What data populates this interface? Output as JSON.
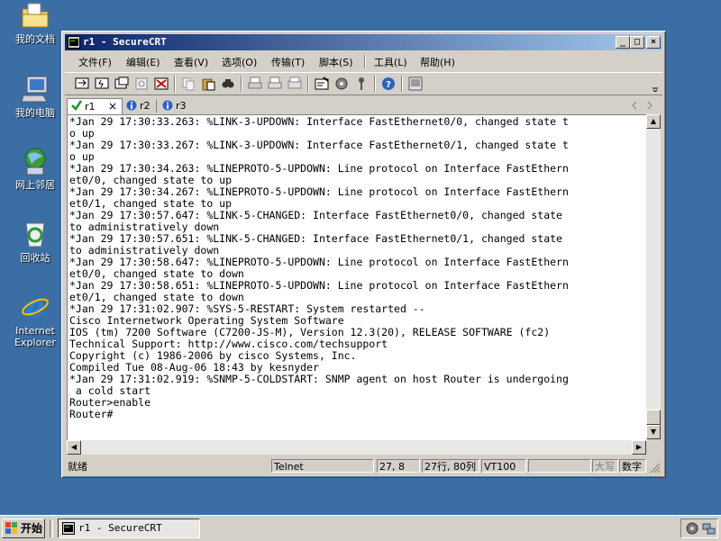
{
  "desktop": {
    "icons": [
      {
        "label": "我的文档",
        "icon": "my-documents-icon"
      },
      {
        "label": "我的电脑",
        "icon": "my-computer-icon"
      },
      {
        "label": "网上邻居",
        "icon": "network-places-icon"
      },
      {
        "label": "回收站",
        "icon": "recycle-bin-icon"
      },
      {
        "label": "Internet\nExplorer",
        "icon": "internet-explorer-icon"
      }
    ]
  },
  "window": {
    "title": "r1 - SecureCRT",
    "menu": [
      "文件(F)",
      "编辑(E)",
      "查看(V)",
      "选项(O)",
      "传输(T)",
      "脚本(S)",
      "工具(L)",
      "帮助(H)"
    ],
    "tabs": [
      {
        "label": "r1",
        "status": "connected",
        "active": true
      },
      {
        "label": "r2",
        "status": "info",
        "active": false
      },
      {
        "label": "r3",
        "status": "info",
        "active": false
      }
    ],
    "terminal_lines": [
      "*Jan 29 17:30:33.263: %LINK-3-UPDOWN: Interface FastEthernet0/0, changed state t",
      "o up",
      "*Jan 29 17:30:33.267: %LINK-3-UPDOWN: Interface FastEthernet0/1, changed state t",
      "o up",
      "*Jan 29 17:30:34.263: %LINEPROTO-5-UPDOWN: Line protocol on Interface FastEthern",
      "et0/0, changed state to up",
      "*Jan 29 17:30:34.267: %LINEPROTO-5-UPDOWN: Line protocol on Interface FastEthern",
      "et0/1, changed state to up",
      "*Jan 29 17:30:57.647: %LINK-5-CHANGED: Interface FastEthernet0/0, changed state",
      "to administratively down",
      "*Jan 29 17:30:57.651: %LINK-5-CHANGED: Interface FastEthernet0/1, changed state",
      "to administratively down",
      "*Jan 29 17:30:58.647: %LINEPROTO-5-UPDOWN: Line protocol on Interface FastEthern",
      "et0/0, changed state to down",
      "*Jan 29 17:30:58.651: %LINEPROTO-5-UPDOWN: Line protocol on Interface FastEthern",
      "et0/1, changed state to down",
      "*Jan 29 17:31:02.907: %SYS-5-RESTART: System restarted --",
      "Cisco Internetwork Operating System Software",
      "IOS (tm) 7200 Software (C7200-JS-M), Version 12.3(20), RELEASE SOFTWARE (fc2)",
      "Technical Support: http://www.cisco.com/techsupport",
      "Copyright (c) 1986-2006 by cisco Systems, Inc.",
      "Compiled Tue 08-Aug-06 18:43 by kesnyder",
      "*Jan 29 17:31:02.919: %SNMP-5-COLDSTART: SNMP agent on host Router is undergoing",
      " a cold start",
      "Router>enable",
      "Router#"
    ],
    "status": {
      "ready": "就绪",
      "protocol": "Telnet",
      "cursor": "27,  8",
      "size": "27行, 80列",
      "emulation": "VT100",
      "blank": "",
      "caps": "大写",
      "num": "数字"
    }
  },
  "taskbar": {
    "start_label": "开始",
    "task_label": "r1 - SecureCRT"
  },
  "colors": {
    "desktop": "#3a6ea5",
    "title_start": "#0a246a",
    "title_end": "#a6caf0",
    "face": "#d4d0c8"
  }
}
